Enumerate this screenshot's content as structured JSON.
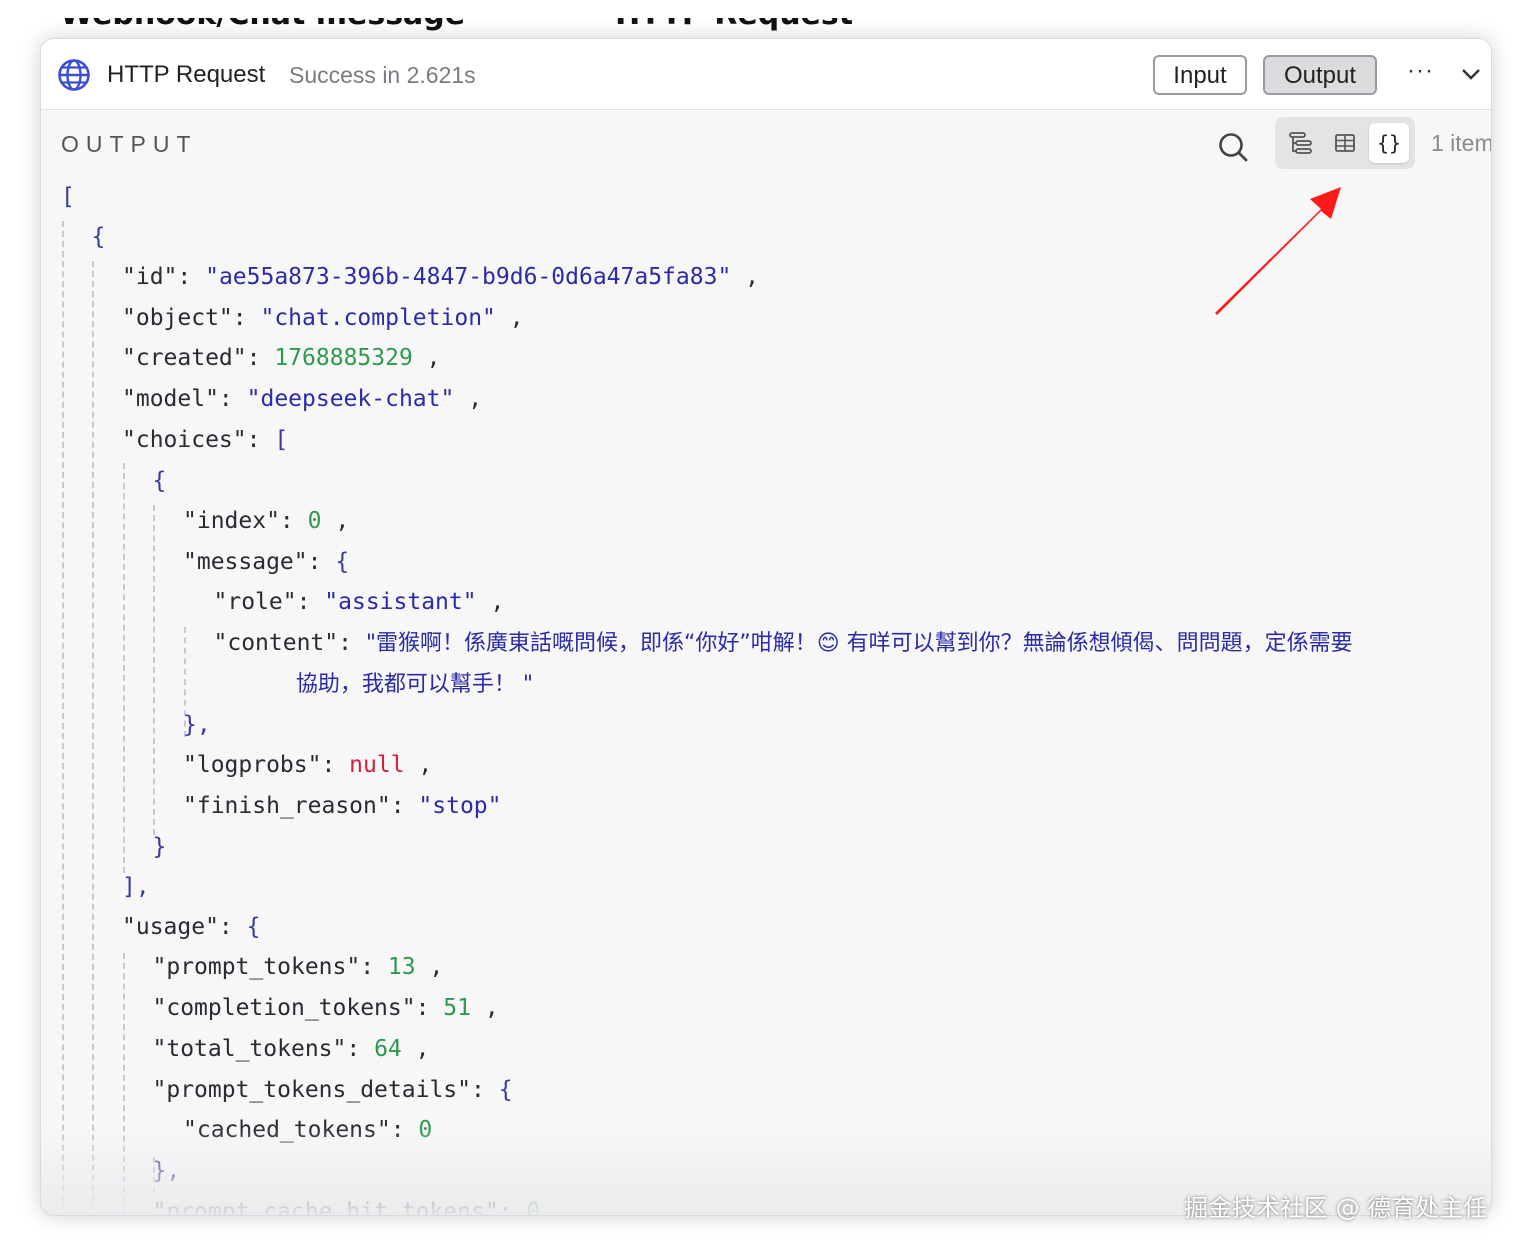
{
  "background_snippet": {
    "left": "Webhook/Chat message",
    "right": "HTTP Request"
  },
  "header": {
    "title": "HTTP Request",
    "status": "Success in 2.621s",
    "input_label": "Input",
    "output_label": "Output",
    "more_label": "···",
    "icon": "globe-icon"
  },
  "output": {
    "section_label": "OUTPUT",
    "item_count": "1 item",
    "active_view": "json",
    "views": [
      "schema",
      "table",
      "json"
    ],
    "json_toggle_label": "{}"
  },
  "json_lines": [
    {
      "k": "",
      "v": "[",
      "t": "p"
    },
    {
      "k": "",
      "v": "{",
      "t": "p"
    },
    {
      "k": "\"id\": ",
      "v": "\"ae55a873-396b-4847-b9d6-0d6a47a5fa83\"",
      "t": "s",
      "c": " ,"
    },
    {
      "k": "\"object\": ",
      "v": "\"chat.completion\"",
      "t": "s",
      "c": " ,"
    },
    {
      "k": "\"created\": ",
      "v": "1768885329",
      "t": "n",
      "c": " ,"
    },
    {
      "k": "\"model\": ",
      "v": "\"deepseek-chat\"",
      "t": "s",
      "c": " ,"
    },
    {
      "k": "\"choices\": ",
      "v": "[",
      "t": "p"
    },
    {
      "k": "",
      "v": "{",
      "t": "p"
    },
    {
      "k": "\"index\": ",
      "v": "0",
      "t": "n",
      "c": " ,"
    },
    {
      "k": "\"message\": ",
      "v": "{",
      "t": "p"
    },
    {
      "k": "\"role\": ",
      "v": "\"assistant\"",
      "t": "s",
      "c": " ,"
    },
    {
      "k": "\"content\": ",
      "v": "\"雷猴啊！係廣東話嘅問候，即係“你好”咁解！😊 有咩可以幫到你？無論係想傾偈、問問題，定係需要",
      "t": "s"
    },
    {
      "k": "",
      "v": "協助，我都可以幫手！ \"",
      "t": "s"
    },
    {
      "k": "",
      "v": "},",
      "t": "p"
    },
    {
      "k": "\"logprobs\": ",
      "v": "null",
      "t": "nl",
      "c": " ,"
    },
    {
      "k": "\"finish_reason\": ",
      "v": "\"stop\"",
      "t": "s"
    },
    {
      "k": "",
      "v": "}",
      "t": "p"
    },
    {
      "k": "",
      "v": "],",
      "t": "p"
    },
    {
      "k": "\"usage\": ",
      "v": "{",
      "t": "p"
    },
    {
      "k": "\"prompt_tokens\": ",
      "v": "13",
      "t": "n",
      "c": " ,"
    },
    {
      "k": "\"completion_tokens\": ",
      "v": "51",
      "t": "n",
      "c": " ,"
    },
    {
      "k": "\"total_tokens\": ",
      "v": "64",
      "t": "n",
      "c": " ,"
    },
    {
      "k": "\"prompt_tokens_details\": ",
      "v": "{",
      "t": "p"
    },
    {
      "k": "\"cached_tokens\": ",
      "v": "0",
      "t": "n"
    },
    {
      "k": "",
      "v": "},",
      "t": "p"
    },
    {
      "k": "\"prompt_cache_hit_tokens\": ",
      "v": "0",
      "t": "n"
    }
  ],
  "watermark": "掘金技术社区 @ 德育处主任",
  "colors": {
    "string": "#2b2ba6",
    "number": "#2e9a4e",
    "null": "#d0223a",
    "punctuation": "#3a3a9e",
    "annotation_arrow": "#ff1a1a"
  }
}
